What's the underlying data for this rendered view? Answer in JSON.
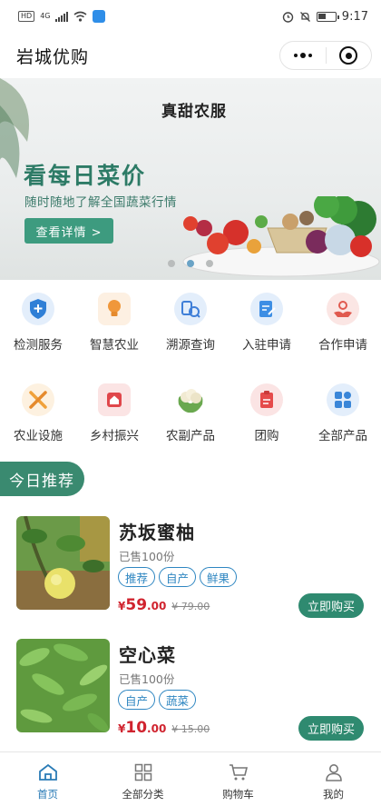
{
  "status_bar": {
    "left_badges": [
      "HD",
      "4G"
    ],
    "time": "9:17"
  },
  "header": {
    "title": "岩城优购",
    "menu_icon": "more-dots-icon",
    "close_icon": "target-circle-icon"
  },
  "banner": {
    "brand": "真甜农服",
    "headline": "看每日菜价",
    "subline": "随时随地了解全国蔬菜行情",
    "button": "查看详情 >",
    "indicator_count": 3,
    "active_index": 1
  },
  "services": [
    {
      "label": "检测服务",
      "icon": "shield-plus-icon",
      "color": "#2f7fd6"
    },
    {
      "label": "智慧农业",
      "icon": "bulb-icon",
      "color": "#f0973a"
    },
    {
      "label": "溯源查询",
      "icon": "trace-icon",
      "color": "#3f7fd8"
    },
    {
      "label": "入驻申请",
      "icon": "edit-form-icon",
      "color": "#3d8ee4"
    },
    {
      "label": "合作申请",
      "icon": "handshake-icon",
      "color": "#e05a4f"
    },
    {
      "label": "农业设施",
      "icon": "tools-icon",
      "color": "#f0a13a"
    },
    {
      "label": "乡村振兴",
      "icon": "house-badge-icon",
      "color": "#e0474b"
    },
    {
      "label": "农副产品",
      "icon": "cauliflower-icon",
      "color": "#6aa84f"
    },
    {
      "label": "团购",
      "icon": "clipboard-icon",
      "color": "#e54b4b"
    },
    {
      "label": "全部产品",
      "icon": "grid-icon",
      "color": "#3a86d8"
    }
  ],
  "section": {
    "title": "今日推荐"
  },
  "products": [
    {
      "name": "苏坂蜜柚",
      "sold": "已售100份",
      "tags": [
        "推荐",
        "自产",
        "鲜果"
      ],
      "price_symbol": "¥",
      "price_int": "59",
      "price_dec": ".00",
      "old_price": "¥ 79.00",
      "buy": "立即购买"
    },
    {
      "name": "空心菜",
      "sold": "已售100份",
      "tags": [
        "自产",
        "蔬菜"
      ],
      "price_symbol": "¥",
      "price_int": "10",
      "price_dec": ".00",
      "old_price": "¥ 15.00",
      "buy": "立即购买"
    }
  ],
  "tabbar": [
    {
      "label": "首页",
      "icon": "home-icon",
      "active": true
    },
    {
      "label": "全部分类",
      "icon": "category-grid-icon",
      "active": false
    },
    {
      "label": "购物车",
      "icon": "cart-icon",
      "active": false
    },
    {
      "label": "我的",
      "icon": "user-icon",
      "active": false
    }
  ],
  "colors": {
    "brand_green": "#3a8a70",
    "price_red": "#d0232e",
    "tag_blue": "#2e86c1",
    "tab_active": "#2a7bb6"
  }
}
